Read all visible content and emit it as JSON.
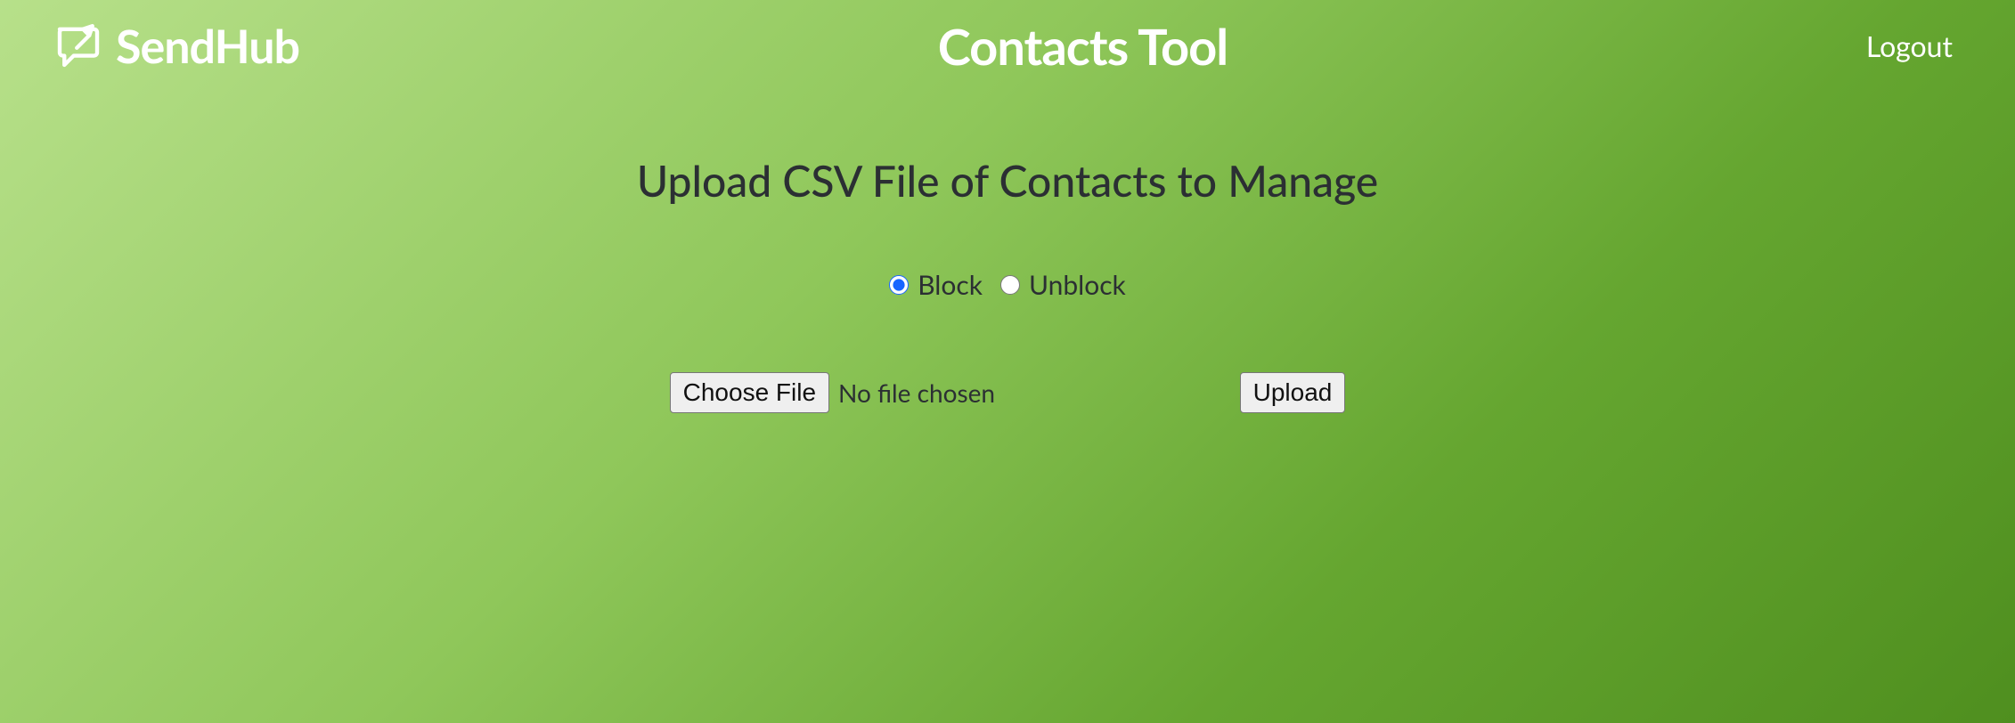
{
  "header": {
    "brand": "SendHub",
    "title": "Contacts Tool",
    "logout": "Logout"
  },
  "main": {
    "subheading": "Upload CSV File of Contacts to Manage",
    "radios": {
      "block_label": "Block",
      "unblock_label": "Unblock",
      "selected": "block"
    },
    "file": {
      "choose_label": "Choose File",
      "status": "No file chosen",
      "upload_label": "Upload"
    }
  }
}
